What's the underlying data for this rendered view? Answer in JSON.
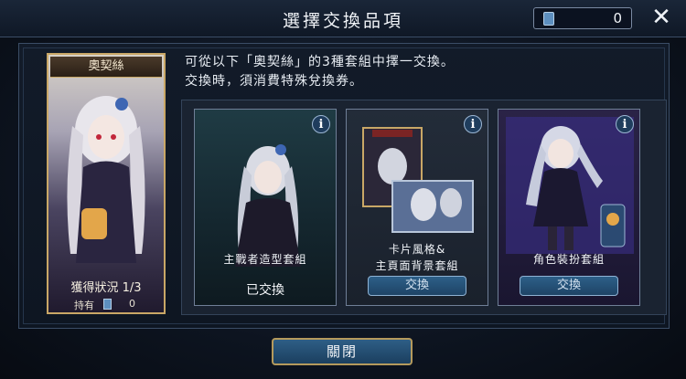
{
  "header": {
    "title": "選擇交換品項",
    "ticket_count": "0",
    "ticket_icon": "exchange-ticket-icon",
    "close_icon": "close-icon"
  },
  "character": {
    "name": "奧契絲",
    "status": "獲得狀況 1/3",
    "owned_label": "持有",
    "owned_value": "0"
  },
  "instructions": {
    "line1": "可從以下「奧契絲」的3種套組中擇一交換。",
    "line2": "交換時，須消費特殊兌換券。"
  },
  "sets": [
    {
      "label": "主戰者造型套組",
      "state": "已交換",
      "info": "i"
    },
    {
      "label_line1": "卡片風格&",
      "label_line2": "主頁面背景套組",
      "button": "交換",
      "info": "i"
    },
    {
      "label": "角色裝扮套組",
      "button": "交換",
      "info": "i"
    }
  ],
  "footer": {
    "close_label": "關閉"
  },
  "colors": {
    "gold_border": "#c9a766",
    "button_blue": "#2d5f88"
  }
}
